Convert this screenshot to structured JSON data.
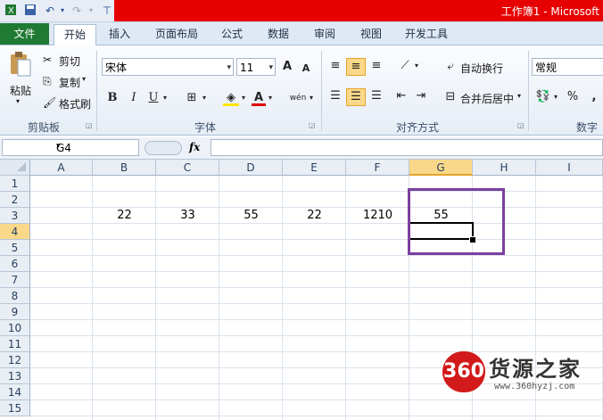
{
  "title_bar": {
    "title": "工作簿1 - Microsoft",
    "quick_access": [
      "save-icon",
      "undo-icon",
      "redo-icon",
      "customize-icon"
    ]
  },
  "tabs": {
    "file": "文件",
    "items": [
      "开始",
      "插入",
      "页面布局",
      "公式",
      "数据",
      "审阅",
      "视图",
      "开发工具"
    ],
    "active": "开始"
  },
  "ribbon": {
    "clipboard": {
      "paste": "粘贴",
      "cut": "剪切",
      "copy": "复制",
      "format_painter": "格式刷",
      "group": "剪贴板"
    },
    "font": {
      "name": "宋体",
      "size": "11",
      "bold": "B",
      "italic": "I",
      "underline": "U",
      "font_color_letter": "A",
      "phonetic": "wén",
      "group": "字体",
      "grow": "A",
      "shrink": "A"
    },
    "alignment": {
      "wrap_text": "自动换行",
      "merge_center": "合并后居中",
      "group": "对齐方式"
    },
    "number": {
      "format": "常规",
      "percent": "%",
      "comma": ",",
      "group": "数字"
    }
  },
  "formula_bar": {
    "name_box": "G4",
    "fx": "fx",
    "formula": ""
  },
  "sheet": {
    "columns": [
      "A",
      "B",
      "C",
      "D",
      "E",
      "F",
      "G",
      "H",
      "I"
    ],
    "rows": [
      "1",
      "2",
      "3",
      "4",
      "5",
      "6",
      "7",
      "8",
      "9",
      "10",
      "11",
      "12",
      "13",
      "14",
      "15"
    ],
    "selected_column": "G",
    "selected_row": "4",
    "row3": {
      "B": "22",
      "C": "33",
      "D": "55",
      "E": "22",
      "F": "1210",
      "G": "55"
    }
  },
  "watermark": {
    "logo": "360",
    "name": "货源之家",
    "url": "www.360hyzj.com"
  },
  "colors": {
    "title_red": "#e60000",
    "file_tab": "#1f7a33",
    "highlight_box": "#7b3fa0",
    "selected_header": "#f9d889"
  }
}
